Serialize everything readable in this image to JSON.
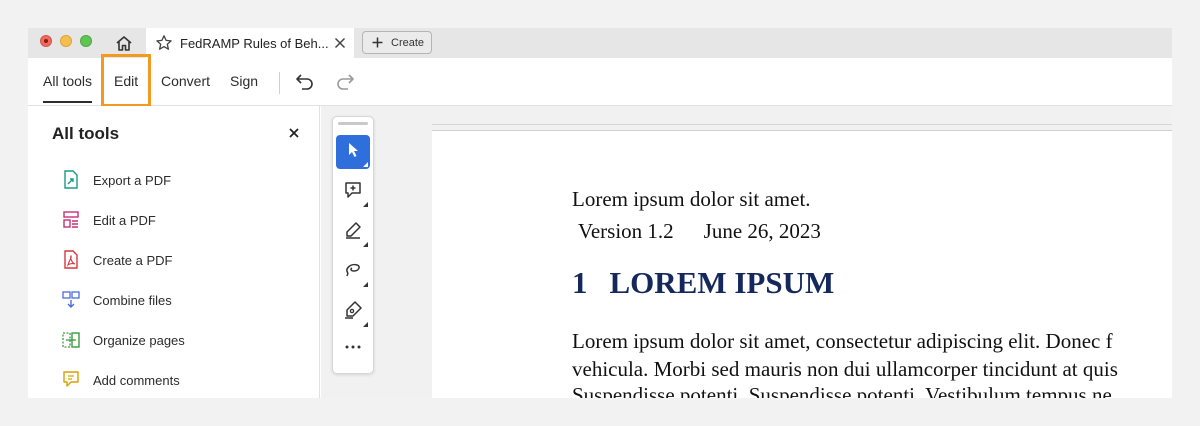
{
  "window": {
    "tab_title": "FedRAMP Rules of Beh...",
    "create_label": "Create"
  },
  "menu": {
    "items": [
      "All tools",
      "Edit",
      "Convert",
      "Sign"
    ],
    "highlight_color": "#f29a1f"
  },
  "panel": {
    "title": "All tools",
    "tools": [
      {
        "label": "Export a PDF",
        "icon": "export-pdf-icon",
        "color": "#1a9a8a"
      },
      {
        "label": "Edit a PDF",
        "icon": "edit-pdf-icon",
        "color": "#c4307a"
      },
      {
        "label": "Create a PDF",
        "icon": "create-pdf-icon",
        "color": "#d7373f"
      },
      {
        "label": "Combine files",
        "icon": "combine-files-icon",
        "color": "#4a6ddb"
      },
      {
        "label": "Organize pages",
        "icon": "organize-pages-icon",
        "color": "#3d9a3d"
      },
      {
        "label": "Add comments",
        "icon": "add-comments-icon",
        "color": "#d9a000"
      }
    ]
  },
  "toolbar": {
    "tools": [
      "select-icon",
      "add-comment-icon",
      "highlight-icon",
      "draw-icon",
      "fill-sign-icon"
    ],
    "more_label": "...",
    "active_color": "#2f6fdb"
  },
  "document": {
    "line1": "Lorem ipsum dolor sit amet.",
    "version": "Version 1.2",
    "date": "June 26, 2023",
    "heading_number": "1",
    "heading_text": "LOREM IPSUM",
    "heading_color": "#14285c",
    "para_line1": "Lorem ipsum dolor sit amet, consectetur adipiscing elit. Donec f",
    "para_line2": "vehicula. Morbi sed mauris non dui ullamcorper tincidunt at quis",
    "para_line3": "Suspendisse potenti. Suspendisse potenti. Vestibulum tempus ne"
  }
}
